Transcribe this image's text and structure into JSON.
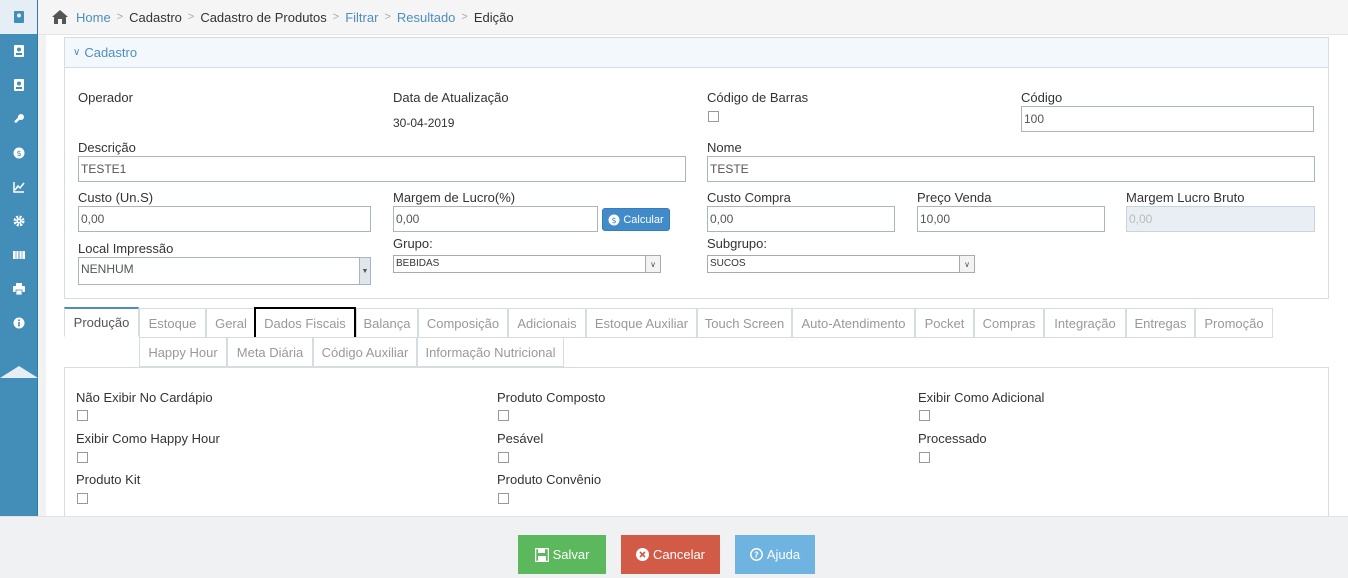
{
  "breadcrumb": [
    "Home",
    "Cadastro",
    "Cadastro de Produtos",
    "Filtrar",
    "Resultado",
    "Edição"
  ],
  "panel": {
    "title": "Cadastro"
  },
  "fields": {
    "operador": {
      "label": "Operador",
      "value": ""
    },
    "data_atualizacao": {
      "label": "Data de Atualização",
      "value": "30-04-2019"
    },
    "codigo_barras": {
      "label": "Código de Barras"
    },
    "codigo": {
      "label": "Código",
      "value": "100"
    },
    "descricao": {
      "label": "Descrição",
      "value": "TESTE1"
    },
    "nome": {
      "label": "Nome",
      "value": "TESTE"
    },
    "custo": {
      "label": "Custo (Un.S)",
      "value": "0,00"
    },
    "margem_lucro": {
      "label": "Margem de Lucro(%)",
      "value": "0,00"
    },
    "calcular": {
      "label": "Calcular"
    },
    "custo_compra": {
      "label": "Custo Compra",
      "value": "0,00"
    },
    "preco_venda": {
      "label": "Preço Venda",
      "value": "10,00"
    },
    "margem_bruto": {
      "label": "Margem Lucro Bruto",
      "value": "0,00"
    },
    "local_impressao": {
      "label": "Local Impressão",
      "value": "NENHUM"
    },
    "grupo": {
      "label": "Grupo:",
      "value": "BEBIDAS"
    },
    "subgrupo": {
      "label": "Subgrupo:",
      "value": "SUCOS"
    }
  },
  "tabs_row1": [
    "Produção",
    "Estoque",
    "Geral",
    "Dados Fiscais",
    "Balança",
    "Composição",
    "Adicionais",
    "Estoque Auxiliar",
    "Touch Screen",
    "Auto-Atendimento",
    "Pocket",
    "Compras",
    "Integração",
    "Entregas",
    "Promoção"
  ],
  "tabs_row2": [
    "Happy Hour",
    "Meta Diária",
    "Código Auxiliar",
    "Informação Nutricional"
  ],
  "checkboxes": {
    "nao_exibir_cardapio": "Não Exibir No Cardápio",
    "produto_composto": "Produto Composto",
    "exibir_como_adicional": "Exibir Como Adicional",
    "exibir_happy_hour": "Exibir Como Happy Hour",
    "pesavel": "Pesável",
    "processado": "Processado",
    "produto_kit": "Produto Kit",
    "produto_convenio": "Produto Convênio"
  },
  "footer": {
    "save": "Salvar",
    "cancel": "Cancelar",
    "help": "Ajuda"
  },
  "colors": {
    "sidebar": "#438eb9",
    "save": "#5cb85c",
    "cancel": "#d15b47",
    "help": "#6fb3e0"
  }
}
